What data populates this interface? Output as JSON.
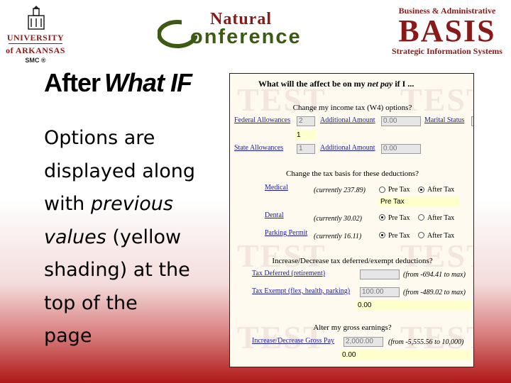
{
  "logos": {
    "ua": {
      "line1": "UNIVERSITY",
      "line2": "of ARKANSAS",
      "mark": "SMC ®"
    },
    "natural": {
      "top": "Natural",
      "bottom": "onference"
    },
    "basis": {
      "top": "Business & Administrative",
      "word": "BASIS",
      "bottom": "Strategic Information Systems"
    }
  },
  "slide": {
    "title_plain": "After",
    "title_italic": "What IF",
    "body": {
      "l1": "Options are",
      "l2": "displayed along",
      "l3a": "with ",
      "l3b": "previous",
      "l4a": "values",
      "l4b": " (yellow",
      "l5": "shading) at the",
      "l6": "top of the",
      "l7": "page"
    }
  },
  "screenshot": {
    "watermark": "TEST",
    "heading": {
      "a": "What will the affect be on my ",
      "b": "net pay",
      "c": " if I ..."
    },
    "income_tax": {
      "section": "Change my income tax (W4) options?",
      "federal_label": "Federal Allowances",
      "federal_value": "2",
      "federal_prev": "1",
      "additional_label": "Additional Amount",
      "additional_value": "0.00",
      "marital_label": "Marital Status",
      "marital_value": "S",
      "state_label": "State Allowances",
      "state_value": "1",
      "state_additional_label": "Additional Amount",
      "state_additional_value": "0.00"
    },
    "tax_basis": {
      "section": "Change the tax basis for these deductions?",
      "pre_tax": "Pre Tax",
      "after_tax": "After Tax",
      "medical_label": "Medical",
      "medical_current": "(currently 237.89)",
      "medical_prev": "Pre Tax",
      "dental_label": "Dental",
      "dental_current": "(currently 30.02)",
      "parking_label": "Parking Permit",
      "parking_current": "(currently 16.11)"
    },
    "deferred": {
      "section": "Increase/Decrease tax deferred/exempt deductions?",
      "deferred_label": "Tax Deferred (retirement)",
      "deferred_range": "(from -694.41 to max)",
      "exempt_label": "Tax Exempt (flex, health, parking)",
      "exempt_value": "100.00",
      "exempt_range": "(from -489.02 to max)",
      "exempt_prev": "0.00"
    },
    "gross": {
      "section": "Alter my gross earnings?",
      "label": "Increase/Decrease Gross Pay",
      "value": "2,000.00",
      "range": "(from -5,555.56 to 10,000)",
      "prev": "0.00"
    }
  }
}
